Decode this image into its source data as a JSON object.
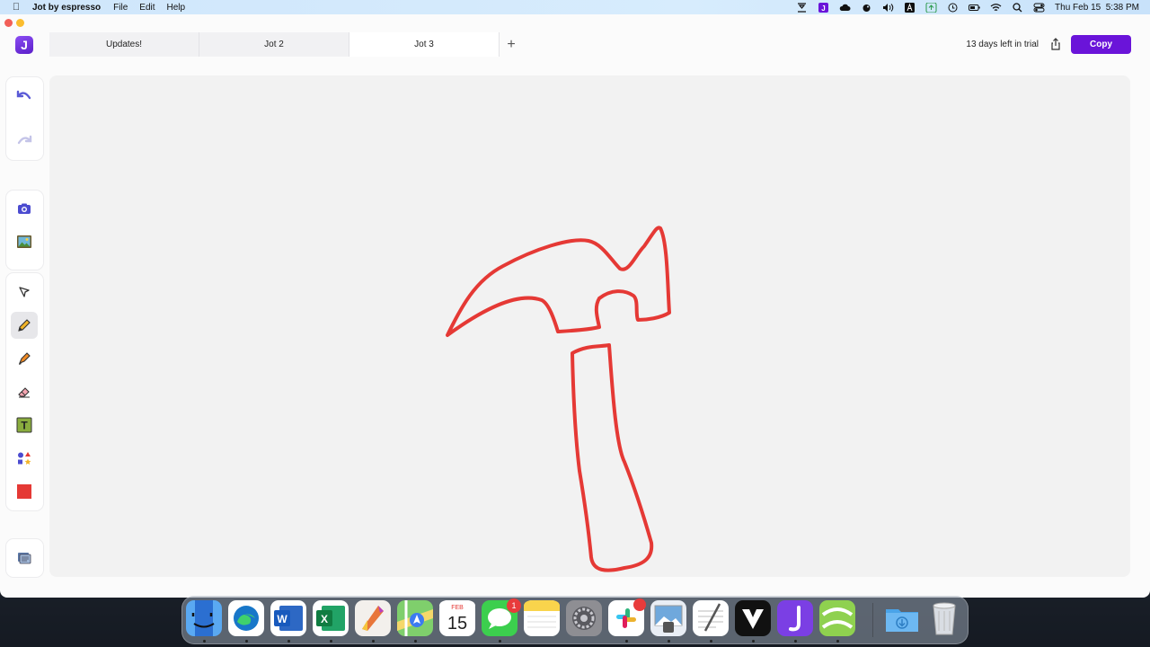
{
  "menubar": {
    "app_name": "Jot by espresso",
    "menus": [
      "File",
      "Edit",
      "Help"
    ],
    "clock": "Thu Feb 15  5:38 PM"
  },
  "app": {
    "logo_letter": "J",
    "tabs": [
      {
        "label": "Updates!",
        "active": false
      },
      {
        "label": "Jot 2",
        "active": false
      },
      {
        "label": "Jot 3",
        "active": true
      }
    ],
    "add_tab": "+",
    "trial_text": "13 days left in trial",
    "copy_label": "Copy",
    "accent_color": "#6a14d9",
    "stroke_color": "#e53935"
  },
  "tools": {
    "history": [
      "undo-icon",
      "redo-icon"
    ],
    "media": [
      "camera-icon",
      "image-icon"
    ],
    "drawing": [
      "select-icon",
      "pencil-icon",
      "marker-icon",
      "eraser-icon",
      "text-icon",
      "shapes-icon",
      "color-swatch-icon"
    ],
    "selected": "pencil-icon",
    "bottom": "layers-icon",
    "text_tool_letter": "T"
  },
  "dock": {
    "apps": [
      "finder",
      "edge",
      "word",
      "excel",
      "affinity",
      "maps",
      "calendar",
      "messages",
      "notes",
      "system-settings",
      "slack",
      "preview",
      "textedit",
      "vectorworks",
      "jot",
      "xcode-alt",
      "downloads",
      "trash"
    ],
    "calendar_month": "FEB",
    "calendar_day": "15",
    "messages_badge": "1"
  }
}
